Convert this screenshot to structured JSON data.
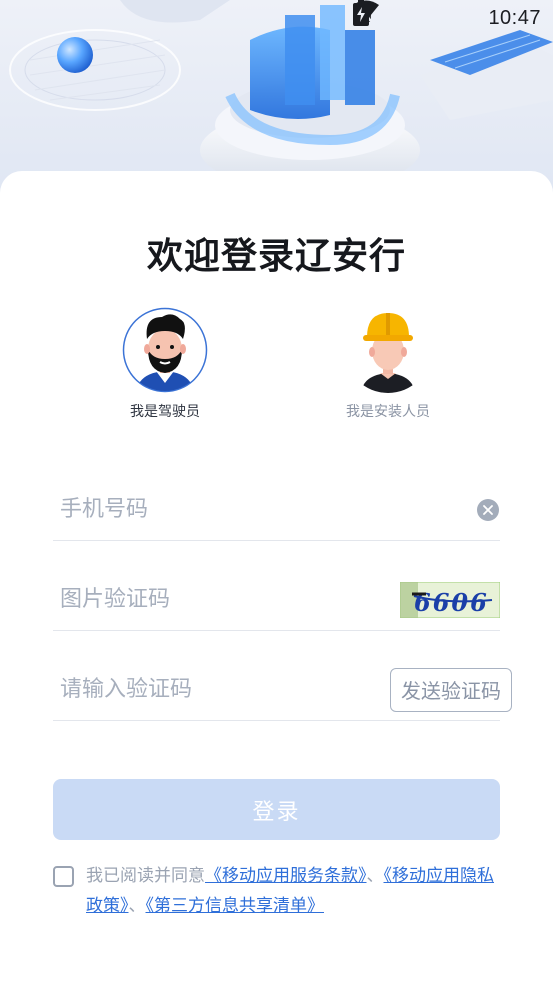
{
  "status_bar": {
    "time": "10:47",
    "icons": [
      "wifi-icon",
      "no-sim-icon",
      "battery-charging-icon"
    ]
  },
  "login": {
    "title": "欢迎登录辽安行",
    "roles": [
      {
        "label": "我是驾驶员",
        "avatar": "driver-avatar",
        "selected": true
      },
      {
        "label": "我是安装人员",
        "avatar": "installer-avatar",
        "selected": false
      }
    ],
    "phone_placeholder": "手机号码",
    "captcha_placeholder": "图片验证码",
    "captcha_text": "6606",
    "sms_placeholder": "请输入验证码",
    "send_code_label": "发送验证码",
    "login_label": "登录",
    "agreement": {
      "prefix": "我已阅读并同意",
      "link1": "《移动应用服务条款》",
      "sep1": "、",
      "link2": "《移动应用隐私政策》",
      "sep2": "、",
      "link3": "《第三方信息共享清单》"
    }
  },
  "colors": {
    "primary_disabled": "#c9daf5",
    "link": "#2f6fd9",
    "placeholder": "#a7afbd"
  }
}
